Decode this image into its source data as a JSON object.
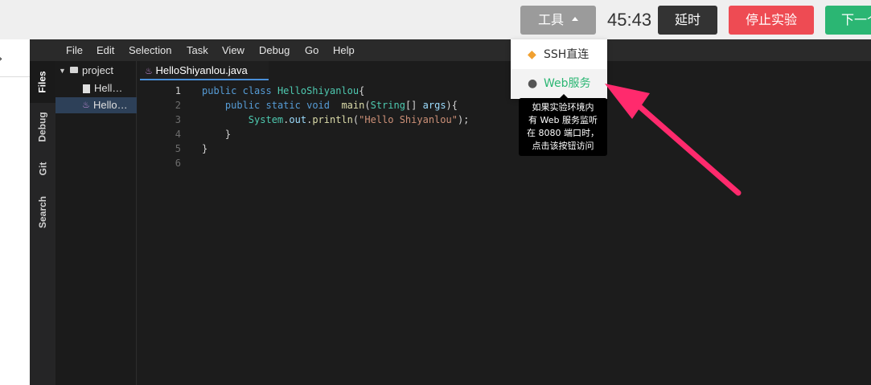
{
  "header": {
    "tools_label": "工具",
    "timer": "45:43",
    "extend_label": "延时",
    "stop_label": "停止实验",
    "next_label": "下一个"
  },
  "menu": [
    "File",
    "Edit",
    "Selection",
    "Task",
    "View",
    "Debug",
    "Go",
    "Help"
  ],
  "activity_tabs": [
    "Files",
    "Debug",
    "Git",
    "Search"
  ],
  "file_tree": {
    "folder": "project",
    "files": [
      "Hell…",
      "Hello…"
    ]
  },
  "editor": {
    "tab_title": "HelloShiyanlou.java",
    "line_numbers": [
      "1",
      "2",
      "3",
      "4",
      "5",
      "6"
    ]
  },
  "dropdown": {
    "ssh_label": "SSH直连",
    "web_label": "Web服务",
    "ssh_icon": "diamond-icon",
    "web_icon": "user-icon"
  },
  "tooltip": {
    "lines": [
      "如果实验环境内",
      "有 Web 服务监听",
      "在 8080 端口时，",
      "点击该按钮访问"
    ]
  },
  "colors": {
    "tools_button": "#9b9b9b",
    "extend_button": "#333333",
    "stop_button": "#ee4b53",
    "next_button": "#2bb673",
    "arrow": "#ff2a6d",
    "web_link": "#2bb673"
  }
}
